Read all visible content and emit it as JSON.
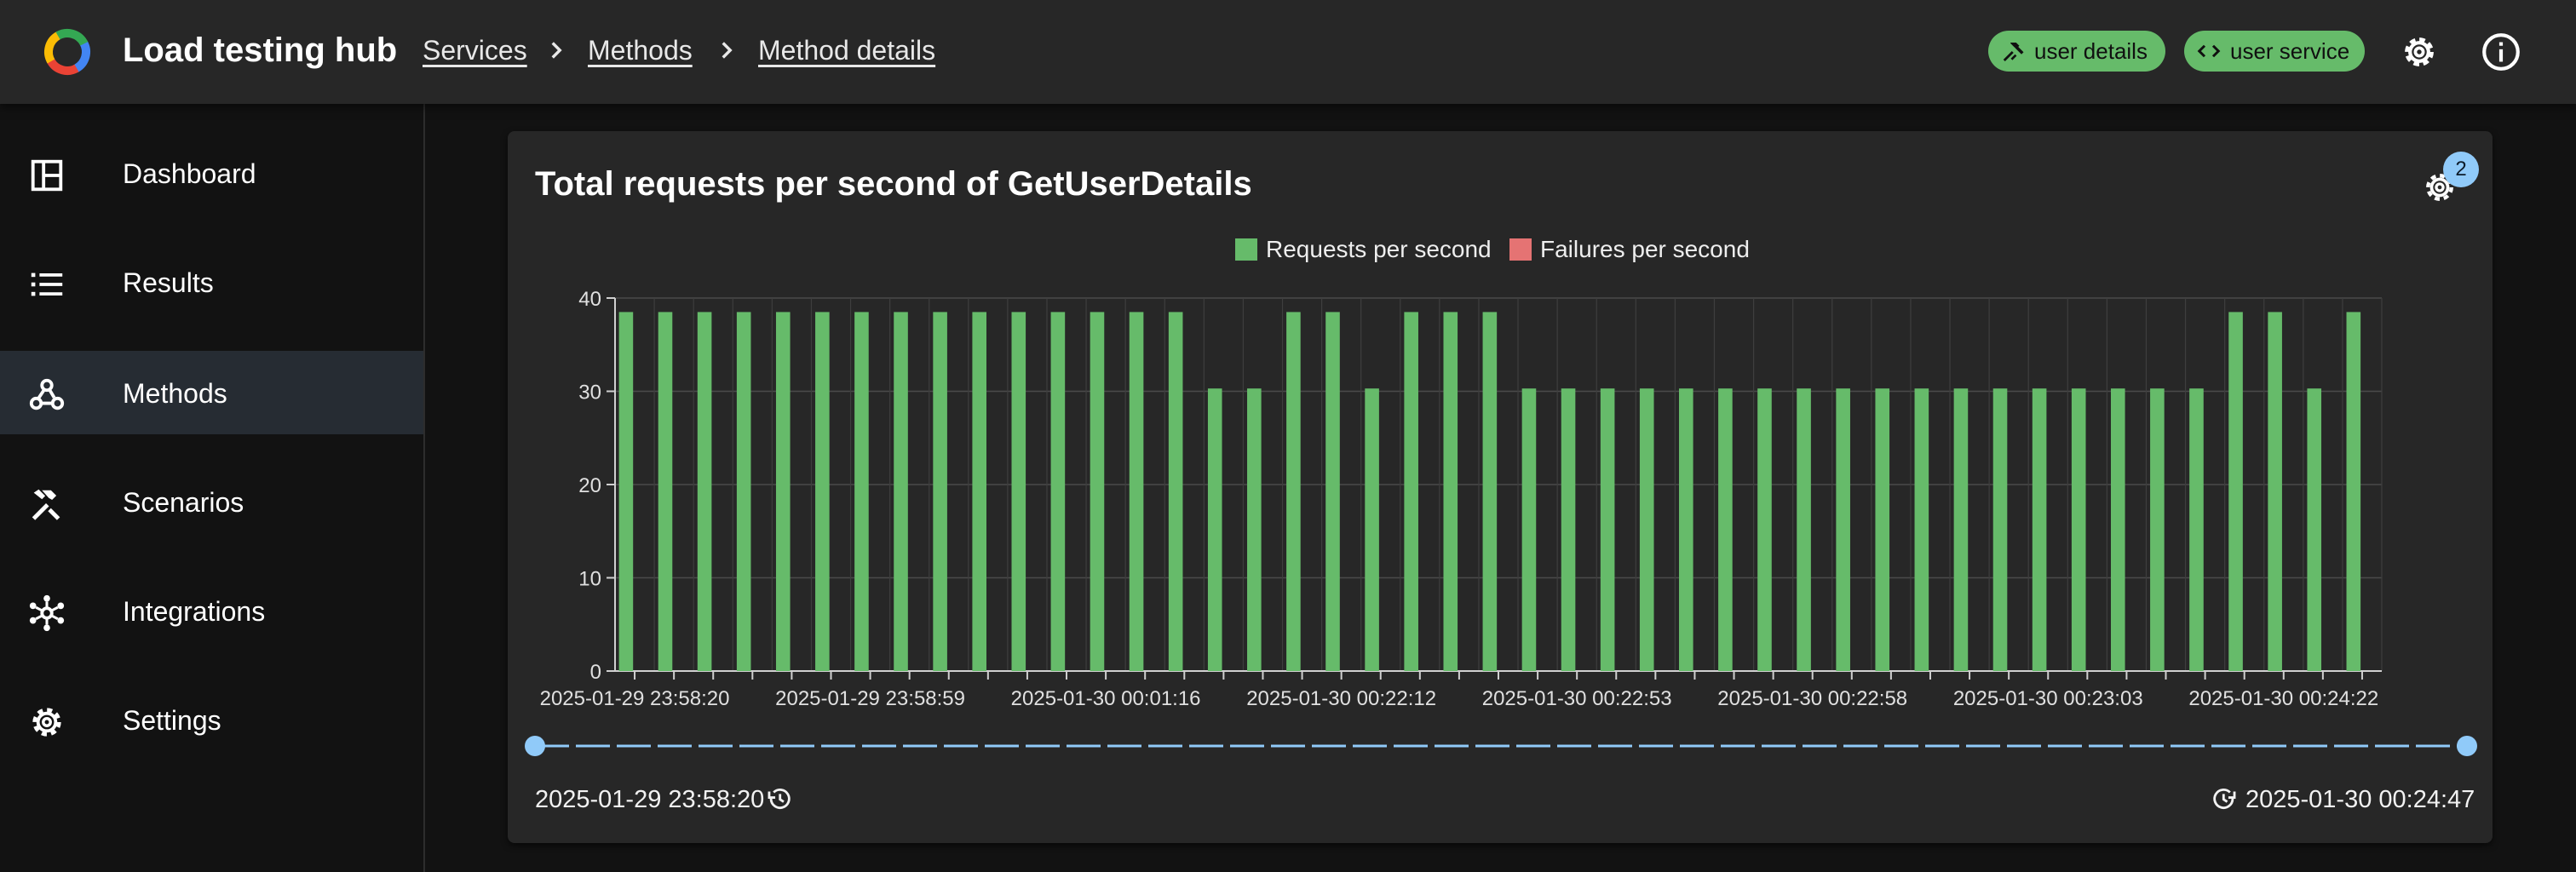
{
  "app": {
    "title": "Load testing hub",
    "logo": "loader-ring-icon"
  },
  "breadcrumbs": [
    {
      "label": "Services"
    },
    {
      "label": "Methods"
    },
    {
      "label": "Method details"
    }
  ],
  "header_chips": [
    {
      "label": "user details",
      "icon": "hammer-wrench-icon"
    },
    {
      "label": "user service",
      "icon": "code-icon"
    }
  ],
  "header_actions": [
    {
      "icon": "gear-icon"
    },
    {
      "icon": "info-icon"
    }
  ],
  "sidebar": {
    "active": "Methods",
    "items": [
      {
        "label": "Dashboard",
        "icon": "dashboard-icon"
      },
      {
        "label": "Results",
        "icon": "list-icon"
      },
      {
        "label": "Methods",
        "icon": "webhook-icon"
      },
      {
        "label": "Scenarios",
        "icon": "tools-icon"
      },
      {
        "label": "Integrations",
        "icon": "hub-icon"
      },
      {
        "label": "Settings",
        "icon": "gear-icon"
      }
    ]
  },
  "card": {
    "title": "Total requests per second of GetUserDetails",
    "settings_badge": "2",
    "range_start": "2025-01-29 23:58:20",
    "range_end": "2025-01-30 00:24:47"
  },
  "colors": {
    "requests": "#66bb6a",
    "failures": "#e57373",
    "slider": "#90caf9",
    "chip": "#66bb6a"
  },
  "chart_data": {
    "type": "bar",
    "title": "Total requests per second of GetUserDetails",
    "xlabel": "",
    "ylabel": "",
    "ylim": [
      0,
      40
    ],
    "yticks": [
      0,
      10,
      20,
      30,
      40
    ],
    "grid": true,
    "legend_position": "top-center",
    "tick_labels": [
      "2025-01-29 23:58:20",
      "2025-01-29 23:58:59",
      "2025-01-30 00:01:16",
      "2025-01-30 00:22:12",
      "2025-01-30 00:22:53",
      "2025-01-30 00:22:58",
      "2025-01-30 00:23:03",
      "2025-01-30 00:24:22"
    ],
    "series": [
      {
        "name": "Requests per second",
        "color": "#66bb6a",
        "values": [
          38.5,
          38.5,
          38.5,
          38.5,
          38.5,
          38.5,
          38.5,
          38.5,
          38.5,
          38.5,
          38.5,
          38.5,
          38.5,
          38.5,
          38.5,
          30.3,
          30.3,
          38.5,
          38.5,
          30.3,
          38.5,
          38.5,
          38.5,
          30.3,
          30.3,
          30.3,
          30.3,
          30.3,
          30.3,
          30.3,
          30.3,
          30.3,
          30.3,
          30.3,
          30.3,
          30.3,
          30.3,
          30.3,
          30.3,
          30.3,
          30.3,
          38.5,
          38.5,
          30.3,
          38.5
        ]
      },
      {
        "name": "Failures per second",
        "color": "#e57373",
        "values": [
          0,
          0,
          0,
          0,
          0,
          0,
          0,
          0,
          0,
          0,
          0,
          0,
          0,
          0,
          0,
          0,
          0,
          0,
          0,
          0,
          0,
          0,
          0,
          0,
          0,
          0,
          0,
          0,
          0,
          0,
          0,
          0,
          0,
          0,
          0,
          0,
          0,
          0,
          0,
          0,
          0,
          0,
          0,
          0,
          0
        ]
      }
    ]
  }
}
